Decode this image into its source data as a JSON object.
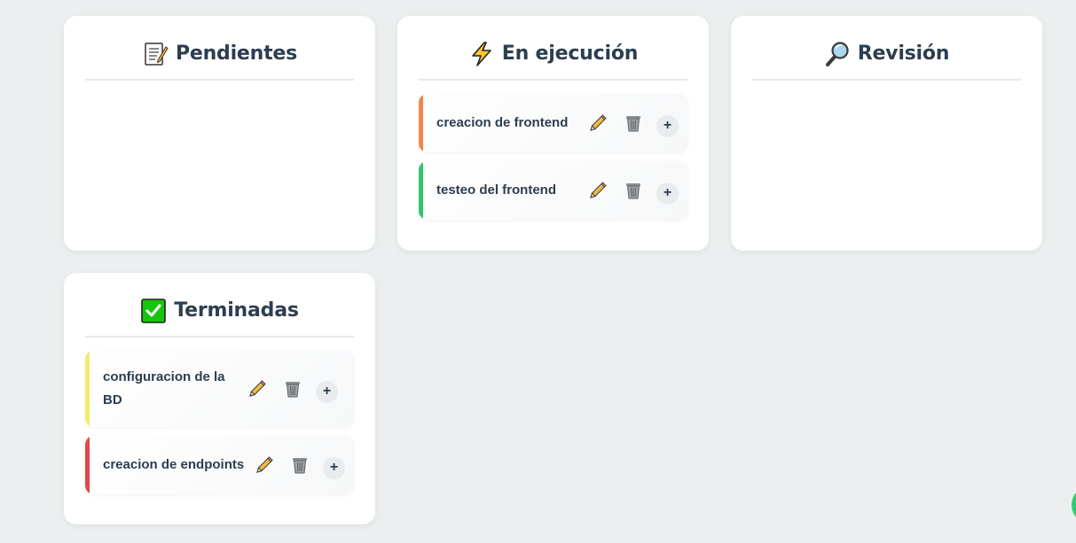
{
  "columns": [
    {
      "title": "Pendientes",
      "icon": "memo-icon",
      "cards": []
    },
    {
      "title": "En ejecución",
      "icon": "lightning-icon",
      "cards": [
        {
          "title": "creacion de frontend",
          "accent": "#f0884a"
        },
        {
          "title": "testeo del frontend",
          "accent": "#2ec76b"
        }
      ]
    },
    {
      "title": "Revisión",
      "icon": "magnifier-icon",
      "cards": []
    },
    {
      "title": "Terminadas",
      "icon": "check-box-icon",
      "cards": [
        {
          "title": "configuracion de la BD",
          "accent": "#f7e96a"
        },
        {
          "title": "creacion de endpoints",
          "accent": "#e84545"
        }
      ]
    }
  ],
  "card_actions": {
    "add_label": "+",
    "edit_icon": "pencil-icon",
    "delete_icon": "trash-icon"
  },
  "colors": {
    "background": "#ecefef",
    "fab": "#2ecc71"
  }
}
